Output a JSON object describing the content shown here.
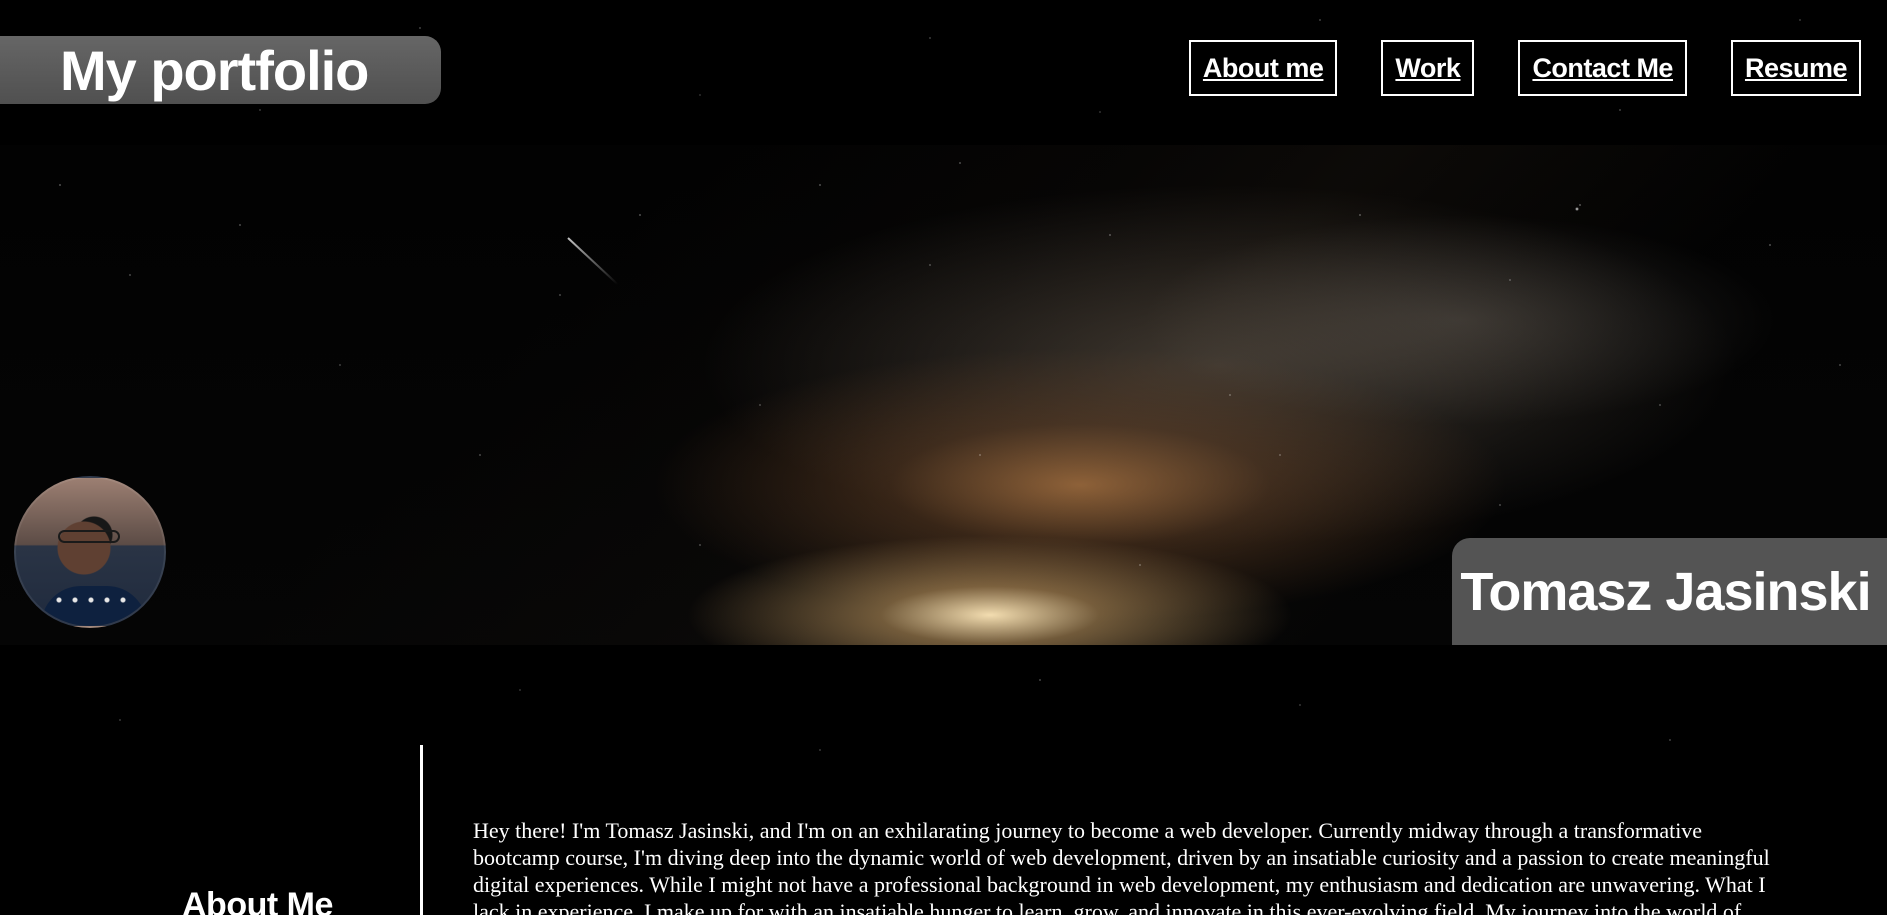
{
  "header": {
    "brand": "My portfolio",
    "nav": [
      "About me",
      "Work",
      "Contact Me",
      "Resume"
    ]
  },
  "hero": {
    "name": "Tomasz Jasinski"
  },
  "about": {
    "title": "About Me",
    "text": "Hey there! I'm Tomasz Jasinski, and I'm on an exhilarating journey to become a web developer. Currently midway through a transformative bootcamp course, I'm diving deep into the dynamic world of web development, driven by an insatiable curiosity and a passion to create meaningful digital experiences. While I might not have a professional background in web development, my enthusiasm and dedication are unwavering. What I lack in experience, I make up for with an insatiable hunger to learn, grow, and innovate in this ever-evolving field. My journey into the world of coding is interwoven with my diverse interests, which significantly"
  },
  "icons": {
    "avatar": "profile-photo",
    "meteor": "meteor-streak"
  }
}
